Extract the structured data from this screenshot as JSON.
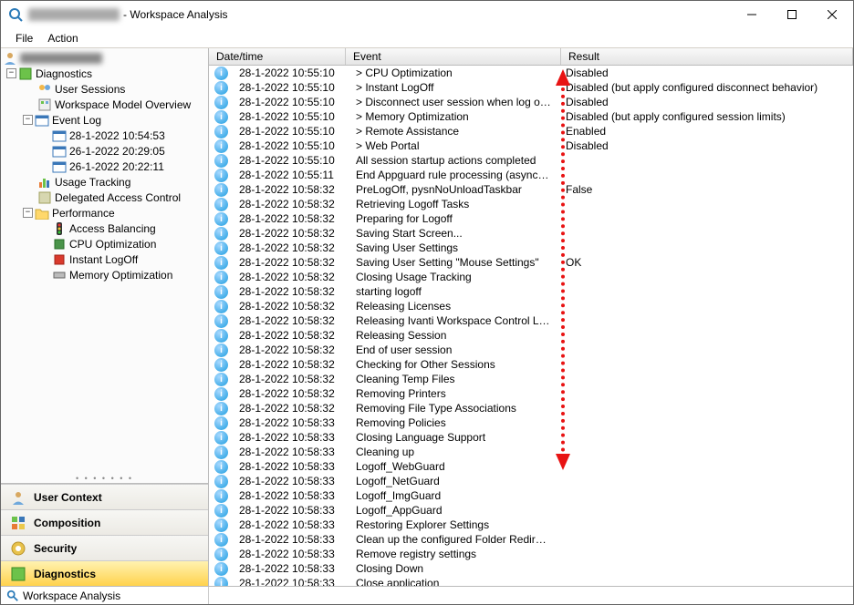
{
  "window": {
    "title_suffix": " - Workspace Analysis"
  },
  "menu": {
    "file": "File",
    "action": "Action"
  },
  "tree": {
    "diagnostics": "Diagnostics",
    "user_sessions": "User Sessions",
    "workspace_model": "Workspace Model Overview",
    "event_log": "Event Log",
    "ev0": "28-1-2022 10:54:53",
    "ev1": "26-1-2022 20:29:05",
    "ev2": "26-1-2022 20:22:11",
    "usage_tracking": "Usage Tracking",
    "delegated": "Delegated Access Control",
    "performance": "Performance",
    "access_balancing": "Access Balancing",
    "cpu_opt": "CPU Optimization",
    "instant_logoff": "Instant LogOff",
    "memory_opt": "Memory Optimization"
  },
  "nav": {
    "user_context": "User Context",
    "composition": "Composition",
    "security": "Security",
    "diagnostics": "Diagnostics"
  },
  "columns": {
    "datetime": "Date/time",
    "event": "Event",
    "result": "Result"
  },
  "rows": [
    {
      "dt": "28-1-2022 10:55:10",
      "ev": "> CPU Optimization",
      "rs": "Disabled"
    },
    {
      "dt": "28-1-2022 10:55:10",
      "ev": "> Instant LogOff",
      "rs": "Disabled (but apply configured disconnect behavior)"
    },
    {
      "dt": "28-1-2022 10:55:10",
      "ev": "> Disconnect user session when log off is initiated",
      "rs": "Disabled"
    },
    {
      "dt": "28-1-2022 10:55:10",
      "ev": "> Memory Optimization",
      "rs": "Disabled (but apply configured session limits)"
    },
    {
      "dt": "28-1-2022 10:55:10",
      "ev": "> Remote Assistance",
      "rs": "Enabled"
    },
    {
      "dt": "28-1-2022 10:55:10",
      "ev": "> Web Portal",
      "rs": "Disabled"
    },
    {
      "dt": "28-1-2022 10:55:10",
      "ev": "All session startup actions completed",
      "rs": ""
    },
    {
      "dt": "28-1-2022 10:55:11",
      "ev": "End Appguard rule processing (asynchronously)",
      "rs": ""
    },
    {
      "dt": "28-1-2022 10:58:32",
      "ev": "PreLogOff, pysnNoUnloadTaskbar",
      "rs": "False"
    },
    {
      "dt": "28-1-2022 10:58:32",
      "ev": "Retrieving Logoff Tasks",
      "rs": ""
    },
    {
      "dt": "28-1-2022 10:58:32",
      "ev": "Preparing for Logoff",
      "rs": ""
    },
    {
      "dt": "28-1-2022 10:58:32",
      "ev": "Saving Start Screen...",
      "rs": ""
    },
    {
      "dt": "28-1-2022 10:58:32",
      "ev": "Saving User Settings",
      "rs": ""
    },
    {
      "dt": "28-1-2022 10:58:32",
      "ev": "Saving User Setting \"Mouse Settings\"",
      "rs": "OK"
    },
    {
      "dt": "28-1-2022 10:58:32",
      "ev": "Closing Usage Tracking",
      "rs": ""
    },
    {
      "dt": "28-1-2022 10:58:32",
      "ev": "starting logoff",
      "rs": ""
    },
    {
      "dt": "28-1-2022 10:58:32",
      "ev": "Releasing Licenses",
      "rs": ""
    },
    {
      "dt": "28-1-2022 10:58:32",
      "ev": "Releasing Ivanti Workspace Control Licenses",
      "rs": ""
    },
    {
      "dt": "28-1-2022 10:58:32",
      "ev": "Releasing Session",
      "rs": ""
    },
    {
      "dt": "28-1-2022 10:58:32",
      "ev": "End of user session",
      "rs": ""
    },
    {
      "dt": "28-1-2022 10:58:32",
      "ev": "Checking for Other Sessions",
      "rs": ""
    },
    {
      "dt": "28-1-2022 10:58:32",
      "ev": "Cleaning Temp Files",
      "rs": ""
    },
    {
      "dt": "28-1-2022 10:58:32",
      "ev": "Removing Printers",
      "rs": ""
    },
    {
      "dt": "28-1-2022 10:58:32",
      "ev": "Removing File Type Associations",
      "rs": ""
    },
    {
      "dt": "28-1-2022 10:58:33",
      "ev": "Removing Policies",
      "rs": ""
    },
    {
      "dt": "28-1-2022 10:58:33",
      "ev": "Closing Language Support",
      "rs": ""
    },
    {
      "dt": "28-1-2022 10:58:33",
      "ev": "Cleaning up",
      "rs": ""
    },
    {
      "dt": "28-1-2022 10:58:33",
      "ev": "Logoff_WebGuard",
      "rs": ""
    },
    {
      "dt": "28-1-2022 10:58:33",
      "ev": "Logoff_NetGuard",
      "rs": ""
    },
    {
      "dt": "28-1-2022 10:58:33",
      "ev": "Logoff_ImgGuard",
      "rs": ""
    },
    {
      "dt": "28-1-2022 10:58:33",
      "ev": "Logoff_AppGuard",
      "rs": ""
    },
    {
      "dt": "28-1-2022 10:58:33",
      "ev": "Restoring Explorer Settings",
      "rs": ""
    },
    {
      "dt": "28-1-2022 10:58:33",
      "ev": "Clean up the configured Folder Redirections",
      "rs": ""
    },
    {
      "dt": "28-1-2022 10:58:33",
      "ev": "Remove registry settings",
      "rs": ""
    },
    {
      "dt": "28-1-2022 10:58:33",
      "ev": "Closing Down",
      "rs": ""
    },
    {
      "dt": "28-1-2022 10:58:33",
      "ev": "Close application",
      "rs": ""
    }
  ],
  "statusbar": {
    "label": "Workspace Analysis"
  }
}
